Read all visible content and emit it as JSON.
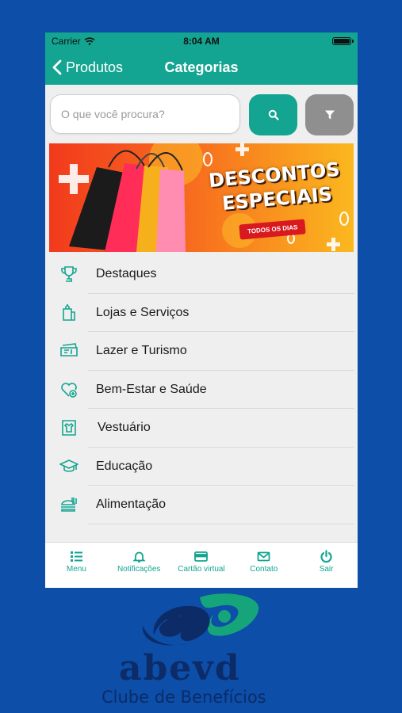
{
  "status_bar": {
    "carrier": "Carrier",
    "time": "8:04 AM"
  },
  "nav": {
    "back_label": "Produtos",
    "title": "Categorias"
  },
  "search": {
    "placeholder": "O que você procura?"
  },
  "banner": {
    "line1": "DESCONTOS",
    "line2": "ESPECIAIS",
    "tag": "TODOS OS DIAS"
  },
  "categories": [
    {
      "label": "Destaques",
      "icon": "trophy-icon"
    },
    {
      "label": "Lojas e Serviços",
      "icon": "shopping-bag-icon"
    },
    {
      "label": "Lazer e Turismo",
      "icon": "ticket-icon"
    },
    {
      "label": "Bem-Estar e Saúde",
      "icon": "heart-health-icon"
    },
    {
      "label": "Vestuário",
      "icon": "clothing-icon"
    },
    {
      "label": "Educação",
      "icon": "graduation-cap-icon"
    },
    {
      "label": "Alimentação",
      "icon": "food-icon"
    }
  ],
  "tabs": [
    {
      "label": "Menu",
      "icon": "list-icon"
    },
    {
      "label": "Notificações",
      "icon": "bell-icon"
    },
    {
      "label": "Cartão virtual",
      "icon": "card-icon"
    },
    {
      "label": "Contato",
      "icon": "envelope-icon"
    },
    {
      "label": "Sair",
      "icon": "power-icon"
    }
  ],
  "brand": {
    "name": "abevd",
    "tagline": "Clube de Benefícios"
  },
  "colors": {
    "primary": "#13a591",
    "background": "#0c4ea8",
    "filter_button": "#8f8f8f",
    "logo_navy": "#0c2b67",
    "logo_green": "#16a57a"
  }
}
